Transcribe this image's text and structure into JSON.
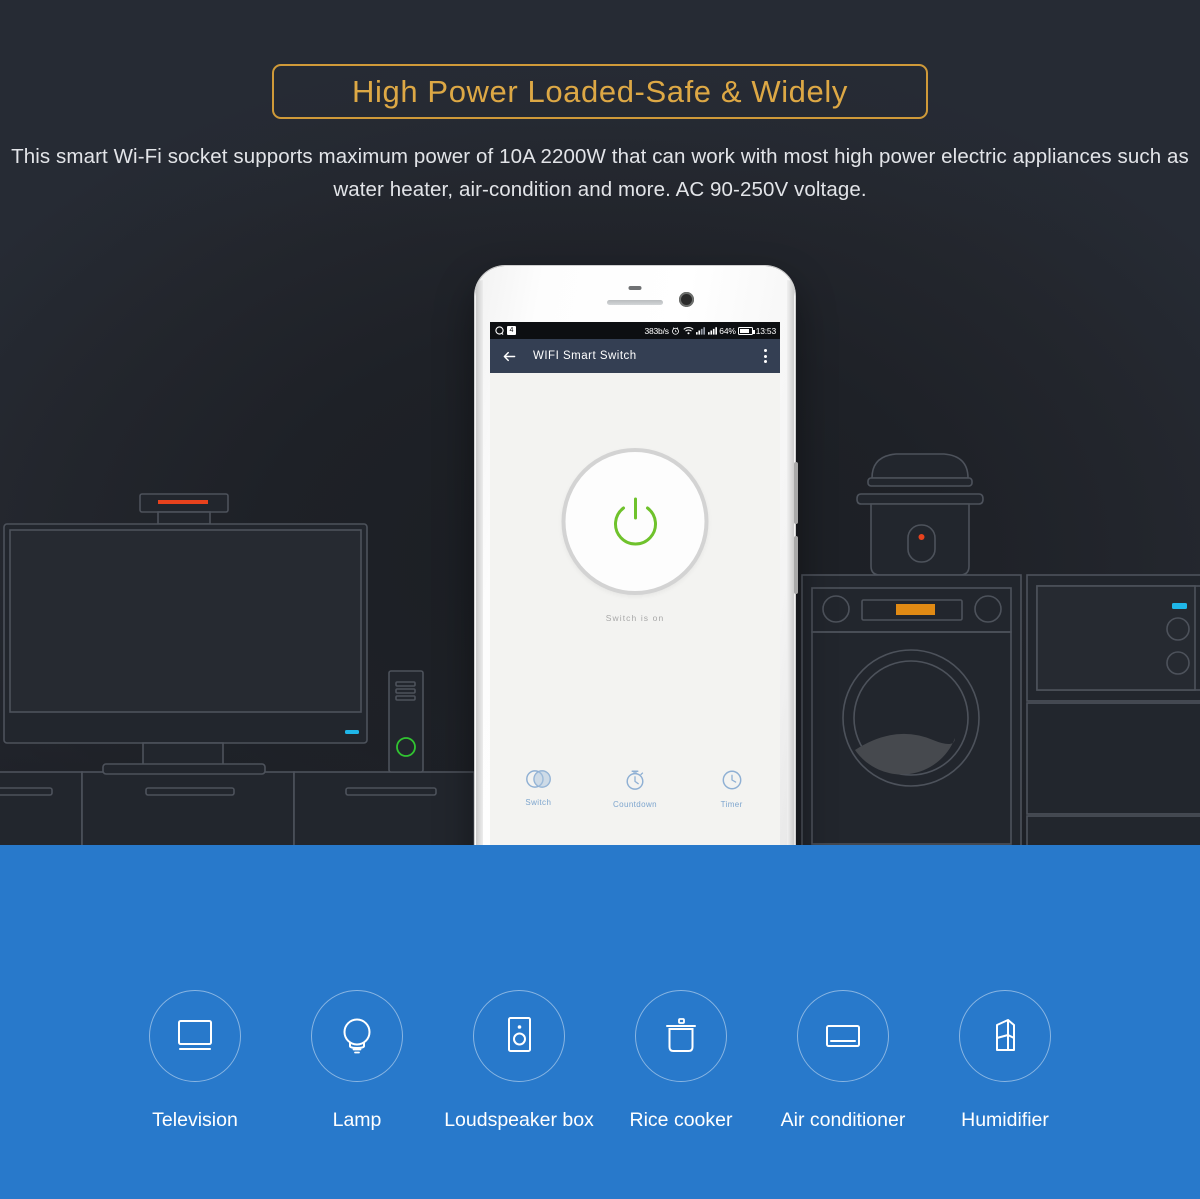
{
  "colors": {
    "dark_bg": "#1e2127",
    "dark_bg_edge": "#262b34",
    "accent_gold": "#dda845",
    "blue_section": "#2879cb",
    "app_header": "#343f53",
    "power_green": "#6fc22c",
    "tab_blue": "#7da5ce",
    "line_art": "#4a4f58",
    "led_red": "#e8421d",
    "led_orange": "#e08a14",
    "led_cyan": "#1fb6e8",
    "led_green": "#31c431"
  },
  "header": {
    "badge_title": "High Power Loaded-Safe & Widely",
    "description": "This smart Wi-Fi socket supports maximum power of 10A 2200W that can work with most high power electric appliances such as water heater, air-condition and more. AC 90-250V voltage."
  },
  "phone": {
    "status_bar": {
      "left_icons": [
        "qq-icon",
        "badge-icon"
      ],
      "net_speed": "383b/s",
      "icons": [
        "alarm-icon",
        "wifi-icon",
        "signal-1-icon",
        "signal-2-icon"
      ],
      "battery_percent": "64%",
      "battery_level": 64,
      "clock": "13:53"
    },
    "app_header": {
      "back_icon": "arrow-left-icon",
      "title": "WIFI Smart Switch",
      "menu_icon": "more-vertical-icon"
    },
    "app_body": {
      "power_icon": "power-icon",
      "switch_state_label": "Switch is on",
      "tabs": [
        {
          "label": "Switch",
          "icon": "toggle-circles-icon"
        },
        {
          "label": "Countdown",
          "icon": "stopwatch-icon"
        },
        {
          "label": "Timer",
          "icon": "clock-icon"
        }
      ]
    },
    "nav_bar": {
      "buttons": [
        {
          "name": "menu-button",
          "icon": "hamburger-icon"
        },
        {
          "name": "home-button",
          "icon": "rounded-square-icon"
        },
        {
          "name": "back-button",
          "icon": "chevron-left-icon"
        }
      ]
    }
  },
  "appliances": [
    {
      "label": "Television",
      "icon": "television-icon"
    },
    {
      "label": "Lamp",
      "icon": "lamp-bulb-icon"
    },
    {
      "label": "Loudspeaker box",
      "icon": "loudspeaker-icon"
    },
    {
      "label": "Rice cooker",
      "icon": "rice-cooker-icon"
    },
    {
      "label": "Air conditioner",
      "icon": "air-conditioner-icon"
    },
    {
      "label": "Humidifier",
      "icon": "humidifier-icon"
    }
  ],
  "background_scene": {
    "items": [
      {
        "name": "tv-monitor",
        "led": "red"
      },
      {
        "name": "tv-stand-cabinets"
      },
      {
        "name": "pc-tower",
        "led": "green"
      },
      {
        "name": "rice-cooker-appliance",
        "led": "red"
      },
      {
        "name": "washing-machine",
        "led": "orange"
      },
      {
        "name": "microwave-oven",
        "led": "cyan"
      },
      {
        "name": "kitchen-cabinet"
      }
    ]
  }
}
